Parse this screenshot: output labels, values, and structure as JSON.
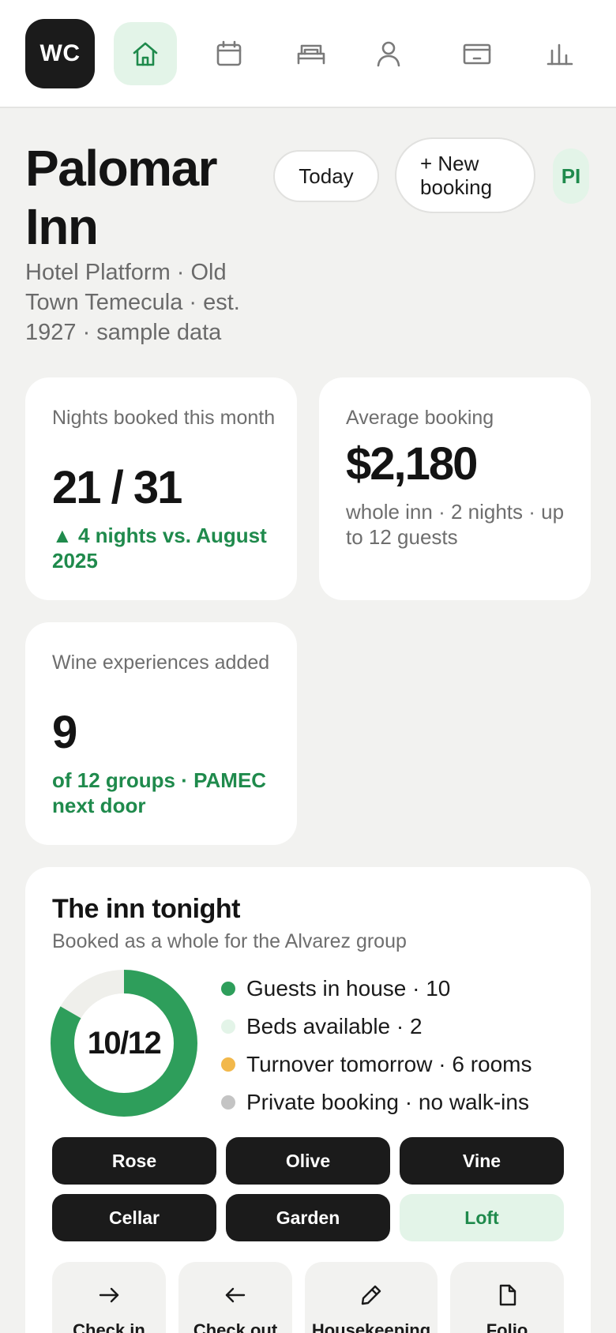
{
  "nav": {
    "logo_text": "WC",
    "items": [
      {
        "icon": "home-icon",
        "active": true
      },
      {
        "icon": "calendar-icon",
        "active": false
      },
      {
        "icon": "bed-icon",
        "active": false
      },
      {
        "icon": "person-icon",
        "active": false
      },
      {
        "icon": "card-icon",
        "active": false
      },
      {
        "icon": "bar-chart-icon",
        "active": false
      }
    ]
  },
  "header": {
    "title": "Palomar Inn",
    "subtitle": "Hotel Platform · Old Town Temecula · est. 1927 · sample data",
    "today_label": "Today",
    "new_booking_label": "+ New booking",
    "avatar_initials": "PI"
  },
  "stats": [
    {
      "label": "Nights booked this month",
      "value": "21 / 31",
      "note": "▲ 4 nights vs. August 2025"
    },
    {
      "label": "Average booking",
      "value": "$2,180",
      "note": "whole inn · 2 nights · up to 12 guests"
    },
    {
      "label": "Wine experiences added",
      "value": "9",
      "note": "of 12 groups · PAMEC next door"
    }
  ],
  "tonight": {
    "title": "The inn tonight",
    "subtitle": "Booked as a whole for the Alvarez group",
    "occupancy_label": "10/12",
    "occupied": 10,
    "capacity": 12,
    "legend": [
      {
        "text": "Guests in house · 10",
        "color": "#2e9e5b"
      },
      {
        "text": "Beds available · 2",
        "color": "#e3f4e8"
      },
      {
        "text": "Turnover tomorrow · 6 rooms",
        "color": "#f2b84b"
      },
      {
        "text": "Private booking · no walk-ins",
        "color": "#c4c4c4"
      }
    ],
    "rooms": [
      {
        "name": "Rose",
        "occupied": true
      },
      {
        "name": "Olive",
        "occupied": true
      },
      {
        "name": "Vine",
        "occupied": true
      },
      {
        "name": "Cellar",
        "occupied": true
      },
      {
        "name": "Garden",
        "occupied": true
      },
      {
        "name": "Loft",
        "occupied": false
      }
    ],
    "actions": [
      {
        "label": "Check in",
        "icon": "arrow-right-icon"
      },
      {
        "label": "Check out",
        "icon": "arrow-left-icon"
      },
      {
        "label": "Housekeeping",
        "icon": "pencil-icon"
      },
      {
        "label": "Folio",
        "icon": "document-icon"
      }
    ]
  },
  "colors": {
    "accent": "#1f8a4c",
    "accent_light": "#e3f4e8",
    "donut_fill": "#2e9e5b",
    "donut_track": "#efefeb",
    "dark": "#1b1b1b"
  }
}
